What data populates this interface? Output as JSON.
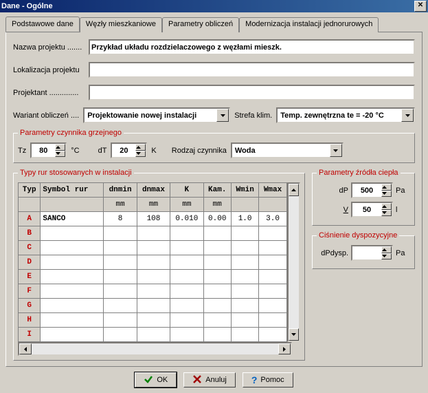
{
  "window": {
    "title": "Dane - Ogólne"
  },
  "tabs": {
    "basic": "Podstawowe dane",
    "nodes": "Węzły mieszkaniowe",
    "params": "Parametry obliczeń",
    "modern": "Modernizacja instalacji jednorurowych"
  },
  "labels": {
    "project_name": "Nazwa projektu .......",
    "project_loc": "Lokalizacja projektu",
    "designer": "Projektant ..............",
    "variant": "Wariant obliczeń ....",
    "climate": "Strefa klim."
  },
  "fields": {
    "project_name": "Przykład układu rozdzielaczowego z węzłami mieszk.",
    "project_loc": "",
    "designer": "",
    "variant": "Projektowanie nowej instalacji",
    "climate": "Temp. zewnętrzna te = -20 °C"
  },
  "heating_group": {
    "legend": "Parametry czynnika grzejnego",
    "tz_label": "Tz",
    "tz_value": "80",
    "tz_unit": "°C",
    "dt_label": "dT",
    "dt_value": "20",
    "dt_unit": "K",
    "medium_label": "Rodzaj czynnika",
    "medium_value": "Woda"
  },
  "tubes_group": {
    "legend": "Typy rur stosowanych w instalacji",
    "headers": [
      "Typ",
      "Symbol rur",
      "dnmin",
      "dnmax",
      "K",
      "Kam.",
      "Wmin",
      "Wmax"
    ],
    "units": [
      "",
      "",
      "mm",
      "mm",
      "mm",
      "mm",
      "",
      ""
    ],
    "rows": [
      {
        "typ": "A",
        "symbol": "SANCO",
        "dnmin": "8",
        "dnmax": "108",
        "k": "0.010",
        "kam": "0.00",
        "wmin": "1.0",
        "wmax": "3.0"
      },
      {
        "typ": "B"
      },
      {
        "typ": "C"
      },
      {
        "typ": "D"
      },
      {
        "typ": "E"
      },
      {
        "typ": "F"
      },
      {
        "typ": "G"
      },
      {
        "typ": "H"
      },
      {
        "typ": "I"
      }
    ]
  },
  "source_group": {
    "legend": "Parametry źródła ciepła",
    "dp_label": "dP",
    "dp_value": "500",
    "dp_unit": "Pa",
    "v_label": "V",
    "v_value": "50",
    "v_unit": "l"
  },
  "pressure_group": {
    "legend": "Ciśnienie dyspozycyjne",
    "dpdysp_label": "dPdysp.",
    "dpdysp_value": "",
    "dpdysp_unit": "Pa"
  },
  "buttons": {
    "ok": "OK",
    "cancel": "Anuluj",
    "help": "Pomoc"
  }
}
